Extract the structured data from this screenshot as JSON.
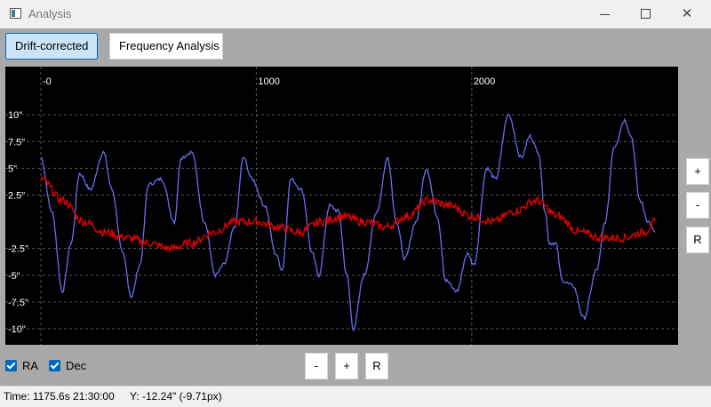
{
  "window": {
    "title": "Analysis",
    "minimize_icon": "minimize-icon",
    "maximize_icon": "maximize-icon",
    "close_icon": "close-icon",
    "close_glyph": "✕"
  },
  "tabs": [
    {
      "label": "Drift-corrected",
      "active": true
    },
    {
      "label": "Frequency Analysis",
      "active": false
    }
  ],
  "plot": {
    "background": "#000000",
    "grid_color": "#555555",
    "x_tick_labels": [
      "-0",
      "1000",
      "2000"
    ],
    "y_tick_labels": [
      "10\"",
      "7.5\"",
      "5\"",
      "2.5\"",
      "-2.5\"",
      "-5\"",
      "-7.5\"",
      "-10\""
    ]
  },
  "chart_data": {
    "type": "line",
    "x_ticks": [
      0,
      1000,
      2000
    ],
    "y_ticks": [
      10,
      7.5,
      5,
      2.5,
      -2.5,
      -5,
      -7.5,
      -10
    ],
    "xlim": [
      0,
      2900
    ],
    "ylim": [
      -11.5,
      14.5
    ],
    "grid": true,
    "legend": "none",
    "series": [
      {
        "name": "RA",
        "color": "#6b6bf0",
        "x": [
          0,
          50,
          100,
          140,
          180,
          230,
          290,
          330,
          380,
          420,
          460,
          500,
          560,
          620,
          650,
          700,
          760,
          810,
          850,
          900,
          940,
          980,
          1040,
          1090,
          1120,
          1160,
          1210,
          1260,
          1290,
          1340,
          1380,
          1420,
          1450,
          1500,
          1560,
          1610,
          1650,
          1690,
          1740,
          1790,
          1840,
          1880,
          1930,
          1980,
          2010,
          2070,
          2110,
          2170,
          2230,
          2270,
          2310,
          2340,
          2360,
          2390,
          2420,
          2470,
          2520,
          2580,
          2620,
          2660,
          2710,
          2740,
          2780,
          2820,
          2850
        ],
        "y": [
          6,
          1,
          -6.5,
          -2,
          4.5,
          3,
          6.5,
          3,
          -3,
          -7,
          -4,
          3.5,
          4,
          0,
          6,
          6.5,
          0,
          -5,
          -4,
          -0.5,
          6,
          4,
          1.5,
          -3,
          -4.5,
          4,
          3,
          -3,
          -5,
          1.5,
          1,
          -5,
          -10,
          -5,
          1,
          6,
          0,
          -3.5,
          0,
          5,
          0.5,
          -5.5,
          -6.5,
          -3,
          -4,
          5,
          4,
          10,
          6,
          8,
          6.5,
          1,
          -2,
          -2,
          -5.5,
          -6,
          -9,
          -4.5,
          0,
          7,
          9.5,
          8,
          2,
          0,
          -1
        ]
      },
      {
        "name": "Dec",
        "color": "#e00000",
        "x": [
          0,
          100,
          200,
          300,
          400,
          500,
          600,
          700,
          800,
          900,
          1000,
          1100,
          1200,
          1300,
          1400,
          1500,
          1600,
          1700,
          1800,
          1900,
          2000,
          2100,
          2200,
          2300,
          2400,
          2500,
          2600,
          2700,
          2800,
          2850
        ],
        "y": [
          4,
          2,
          0,
          -1,
          -1.5,
          -2,
          -2.5,
          -2,
          -1,
          0,
          0,
          -0.5,
          -1,
          0,
          0.5,
          0,
          -0.5,
          0.5,
          2,
          1.5,
          0.5,
          0,
          1,
          2,
          0.5,
          -1,
          -1.5,
          -1.5,
          -1,
          0
        ]
      }
    ]
  },
  "zoom_right": {
    "plus": "+",
    "minus": "-",
    "reset": "R"
  },
  "zoom_bottom": {
    "minus": "-",
    "plus": "+",
    "reset": "R"
  },
  "checkboxes": [
    {
      "label": "RA",
      "checked": true
    },
    {
      "label": "Dec",
      "checked": true
    }
  ],
  "status": {
    "time": "Time: 1175.6s  21:30:00",
    "y_readout": "Y: -12.24\" (-9.71px)"
  }
}
